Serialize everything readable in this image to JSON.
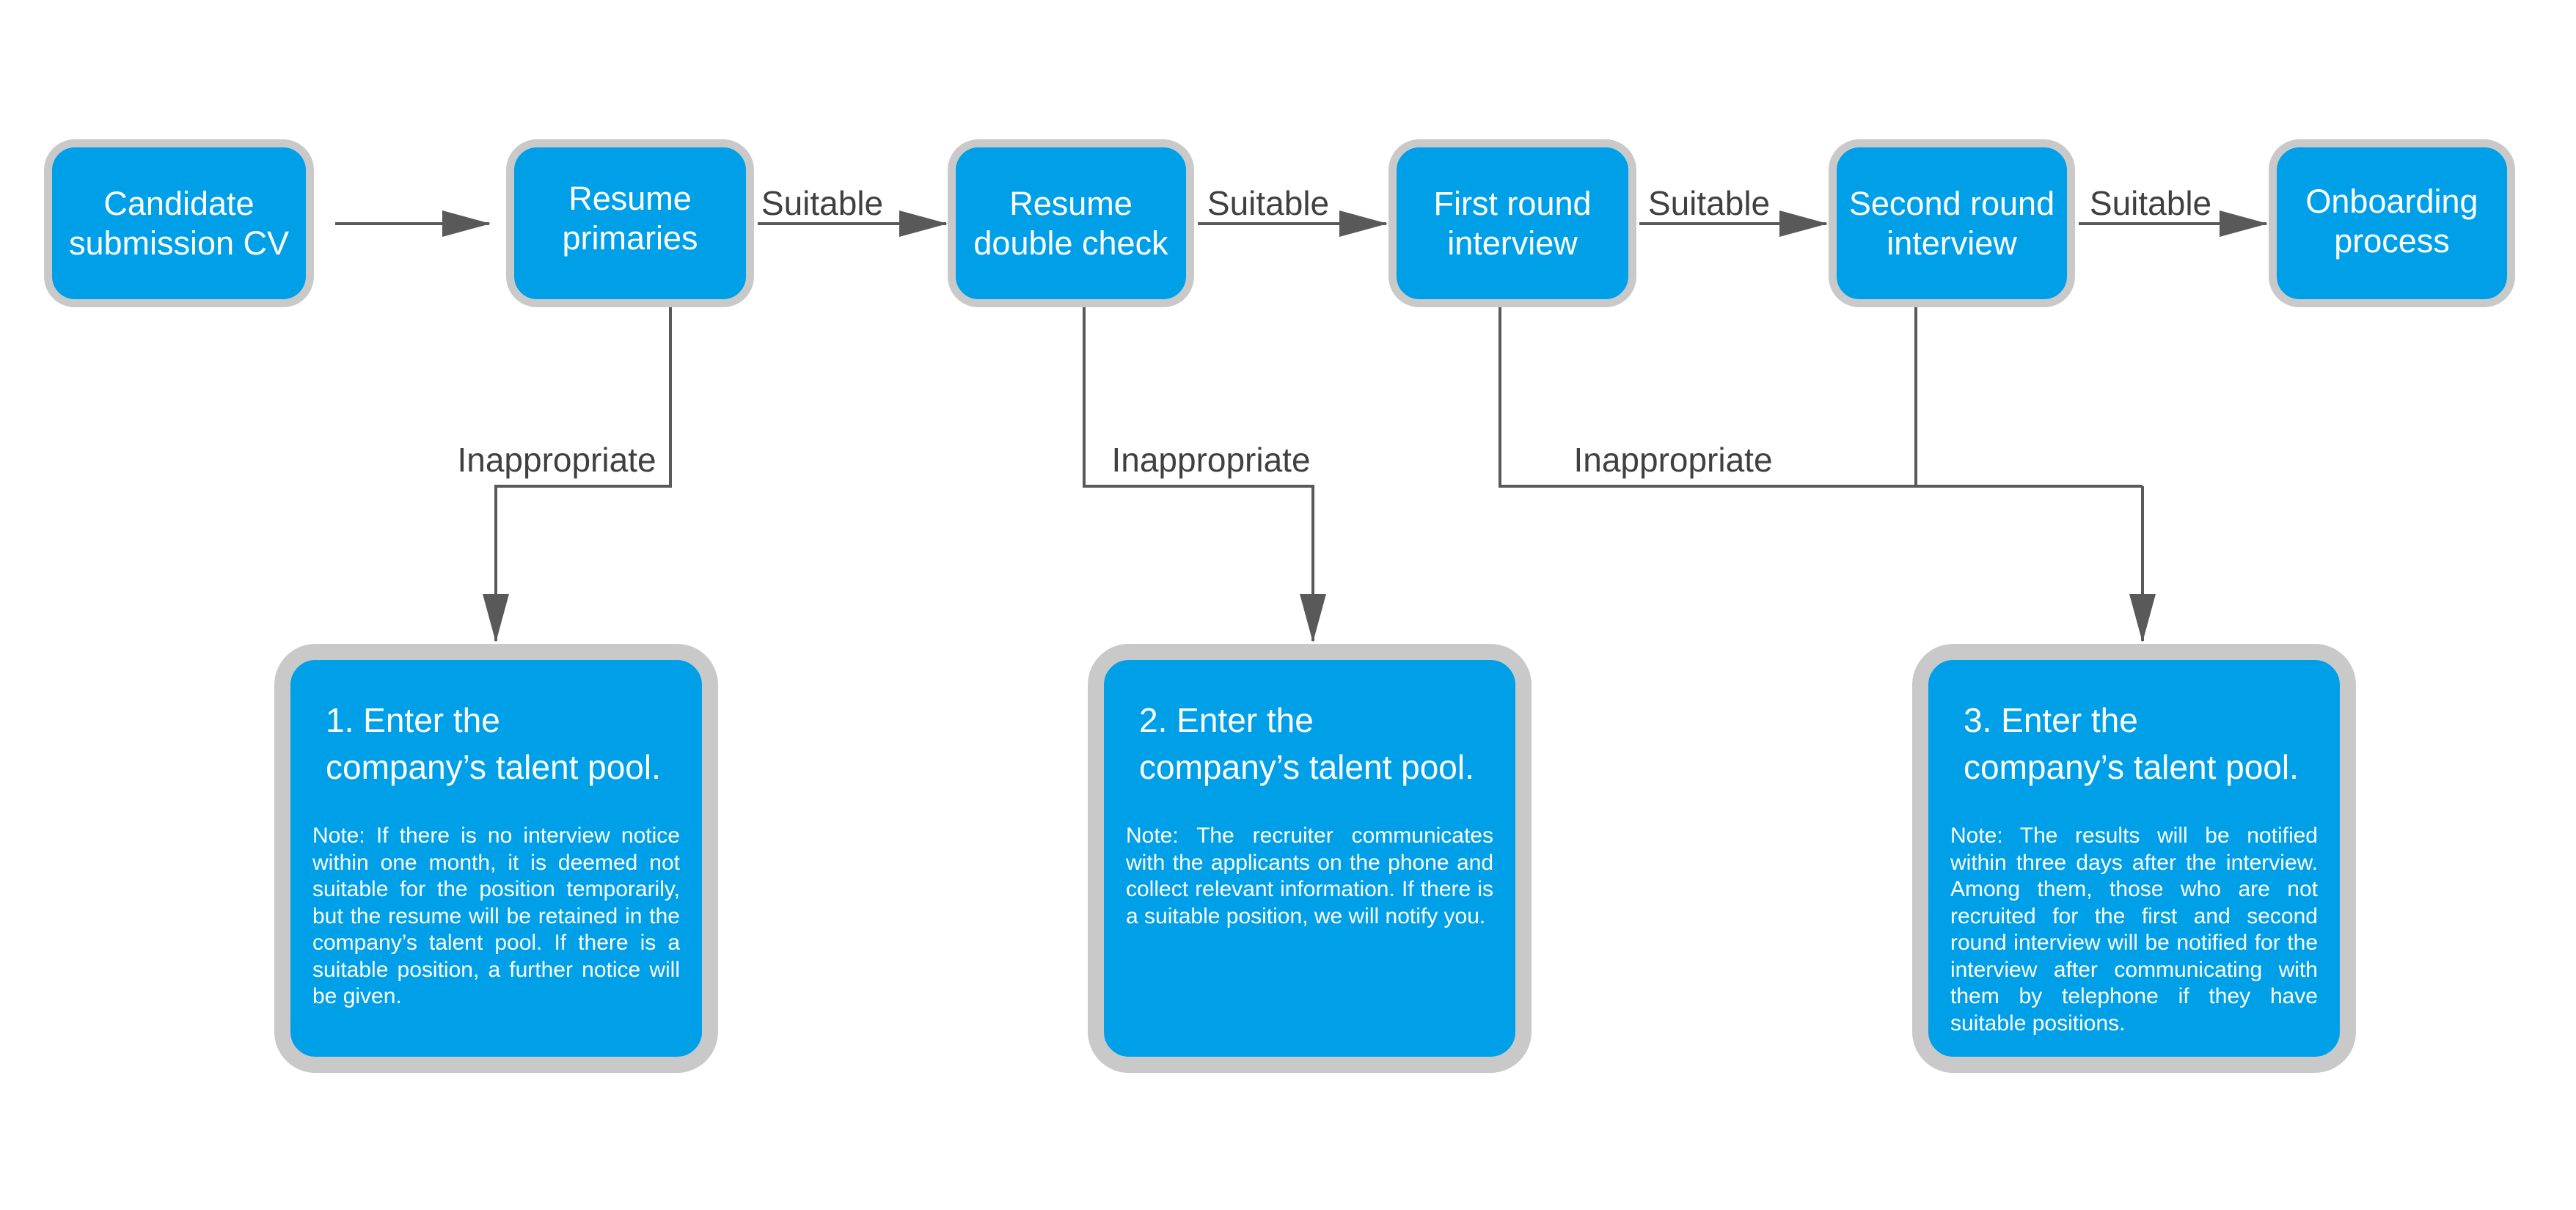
{
  "colors": {
    "box_fill": "#00a0e9",
    "box_border": "#c9c9c9",
    "connector": "#595959",
    "label_text": "#404040"
  },
  "steps": [
    {
      "label": "Candidate submission CV"
    },
    {
      "label": "Resume primaries"
    },
    {
      "label": "Resume double check"
    },
    {
      "label": "First round interview"
    },
    {
      "label": "Second round interview"
    },
    {
      "label": "Onboarding process"
    }
  ],
  "edge_labels": {
    "suitable_1": "Suitable",
    "suitable_2": "Suitable",
    "suitable_3": "Suitable",
    "suitable_4": "Suitable",
    "inappropriate_1": "Inappropriate",
    "inappropriate_2": "Inappropriate",
    "inappropriate_3": "Inappropriate"
  },
  "pools": [
    {
      "title": "1. Enter the company’s talent pool.",
      "note": "Note: If there is no interview notice within one month, it is deemed not suitable for the position temporarily, but the resume will be retained in the company’s talent pool. If there is a suitable position, a further notice will be given."
    },
    {
      "title": "2. Enter the company’s talent pool.",
      "note": "Note: The recruiter communicates with the applicants on the phone and collect relevant information. If there is a suitable position, we will notify you."
    },
    {
      "title": "3. Enter the company’s talent pool.",
      "note": "Note: The results will be notified within three days after the interview. Among them, those who are not recruited for the first and second round interview will be notified for the interview after communicating with them by telephone if they have suitable positions."
    }
  ]
}
